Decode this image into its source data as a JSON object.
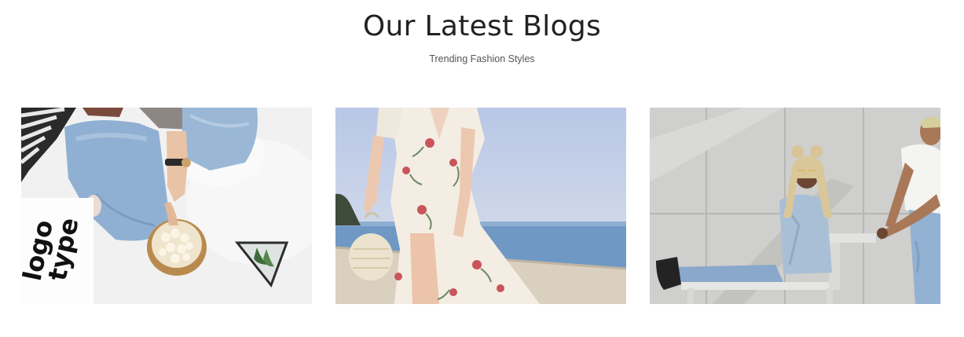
{
  "blog_section": {
    "title": "Our Latest Blogs",
    "subtitle": "Trending Fashion Styles"
  },
  "blog_posts": [
    {
      "image": "flatlay-jeans-popcorn-photo",
      "logo_text_line1": "logo",
      "logo_text_line2": "type"
    },
    {
      "image": "floral-dress-seaside-photo"
    },
    {
      "image": "couple-concrete-wall-bench-photo"
    }
  ],
  "colors": {
    "title": "#222222",
    "subtitle": "#555555",
    "background": "#ffffff"
  }
}
